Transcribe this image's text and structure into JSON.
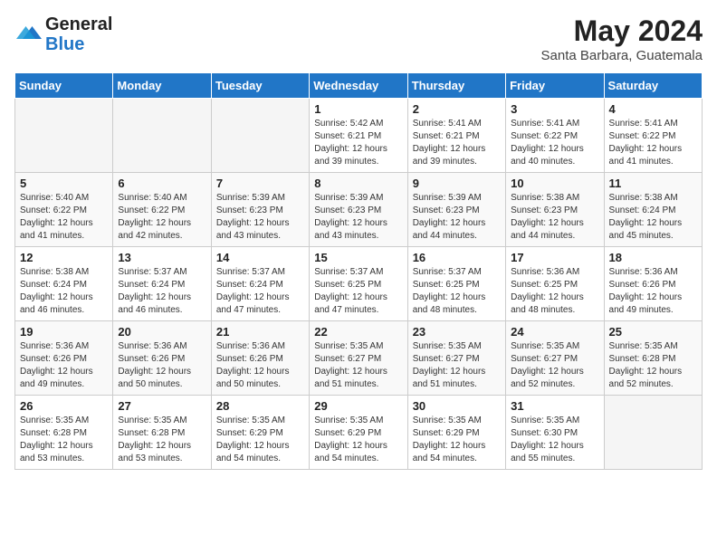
{
  "header": {
    "logo_line1": "General",
    "logo_line2": "Blue",
    "month_title": "May 2024",
    "location": "Santa Barbara, Guatemala"
  },
  "days_of_week": [
    "Sunday",
    "Monday",
    "Tuesday",
    "Wednesday",
    "Thursday",
    "Friday",
    "Saturday"
  ],
  "weeks": [
    [
      {
        "day": "",
        "info": ""
      },
      {
        "day": "",
        "info": ""
      },
      {
        "day": "",
        "info": ""
      },
      {
        "day": "1",
        "info": "Sunrise: 5:42 AM\nSunset: 6:21 PM\nDaylight: 12 hours\nand 39 minutes."
      },
      {
        "day": "2",
        "info": "Sunrise: 5:41 AM\nSunset: 6:21 PM\nDaylight: 12 hours\nand 39 minutes."
      },
      {
        "day": "3",
        "info": "Sunrise: 5:41 AM\nSunset: 6:22 PM\nDaylight: 12 hours\nand 40 minutes."
      },
      {
        "day": "4",
        "info": "Sunrise: 5:41 AM\nSunset: 6:22 PM\nDaylight: 12 hours\nand 41 minutes."
      }
    ],
    [
      {
        "day": "5",
        "info": "Sunrise: 5:40 AM\nSunset: 6:22 PM\nDaylight: 12 hours\nand 41 minutes."
      },
      {
        "day": "6",
        "info": "Sunrise: 5:40 AM\nSunset: 6:22 PM\nDaylight: 12 hours\nand 42 minutes."
      },
      {
        "day": "7",
        "info": "Sunrise: 5:39 AM\nSunset: 6:23 PM\nDaylight: 12 hours\nand 43 minutes."
      },
      {
        "day": "8",
        "info": "Sunrise: 5:39 AM\nSunset: 6:23 PM\nDaylight: 12 hours\nand 43 minutes."
      },
      {
        "day": "9",
        "info": "Sunrise: 5:39 AM\nSunset: 6:23 PM\nDaylight: 12 hours\nand 44 minutes."
      },
      {
        "day": "10",
        "info": "Sunrise: 5:38 AM\nSunset: 6:23 PM\nDaylight: 12 hours\nand 44 minutes."
      },
      {
        "day": "11",
        "info": "Sunrise: 5:38 AM\nSunset: 6:24 PM\nDaylight: 12 hours\nand 45 minutes."
      }
    ],
    [
      {
        "day": "12",
        "info": "Sunrise: 5:38 AM\nSunset: 6:24 PM\nDaylight: 12 hours\nand 46 minutes."
      },
      {
        "day": "13",
        "info": "Sunrise: 5:37 AM\nSunset: 6:24 PM\nDaylight: 12 hours\nand 46 minutes."
      },
      {
        "day": "14",
        "info": "Sunrise: 5:37 AM\nSunset: 6:24 PM\nDaylight: 12 hours\nand 47 minutes."
      },
      {
        "day": "15",
        "info": "Sunrise: 5:37 AM\nSunset: 6:25 PM\nDaylight: 12 hours\nand 47 minutes."
      },
      {
        "day": "16",
        "info": "Sunrise: 5:37 AM\nSunset: 6:25 PM\nDaylight: 12 hours\nand 48 minutes."
      },
      {
        "day": "17",
        "info": "Sunrise: 5:36 AM\nSunset: 6:25 PM\nDaylight: 12 hours\nand 48 minutes."
      },
      {
        "day": "18",
        "info": "Sunrise: 5:36 AM\nSunset: 6:26 PM\nDaylight: 12 hours\nand 49 minutes."
      }
    ],
    [
      {
        "day": "19",
        "info": "Sunrise: 5:36 AM\nSunset: 6:26 PM\nDaylight: 12 hours\nand 49 minutes."
      },
      {
        "day": "20",
        "info": "Sunrise: 5:36 AM\nSunset: 6:26 PM\nDaylight: 12 hours\nand 50 minutes."
      },
      {
        "day": "21",
        "info": "Sunrise: 5:36 AM\nSunset: 6:26 PM\nDaylight: 12 hours\nand 50 minutes."
      },
      {
        "day": "22",
        "info": "Sunrise: 5:35 AM\nSunset: 6:27 PM\nDaylight: 12 hours\nand 51 minutes."
      },
      {
        "day": "23",
        "info": "Sunrise: 5:35 AM\nSunset: 6:27 PM\nDaylight: 12 hours\nand 51 minutes."
      },
      {
        "day": "24",
        "info": "Sunrise: 5:35 AM\nSunset: 6:27 PM\nDaylight: 12 hours\nand 52 minutes."
      },
      {
        "day": "25",
        "info": "Sunrise: 5:35 AM\nSunset: 6:28 PM\nDaylight: 12 hours\nand 52 minutes."
      }
    ],
    [
      {
        "day": "26",
        "info": "Sunrise: 5:35 AM\nSunset: 6:28 PM\nDaylight: 12 hours\nand 53 minutes."
      },
      {
        "day": "27",
        "info": "Sunrise: 5:35 AM\nSunset: 6:28 PM\nDaylight: 12 hours\nand 53 minutes."
      },
      {
        "day": "28",
        "info": "Sunrise: 5:35 AM\nSunset: 6:29 PM\nDaylight: 12 hours\nand 54 minutes."
      },
      {
        "day": "29",
        "info": "Sunrise: 5:35 AM\nSunset: 6:29 PM\nDaylight: 12 hours\nand 54 minutes."
      },
      {
        "day": "30",
        "info": "Sunrise: 5:35 AM\nSunset: 6:29 PM\nDaylight: 12 hours\nand 54 minutes."
      },
      {
        "day": "31",
        "info": "Sunrise: 5:35 AM\nSunset: 6:30 PM\nDaylight: 12 hours\nand 55 minutes."
      },
      {
        "day": "",
        "info": ""
      }
    ]
  ]
}
